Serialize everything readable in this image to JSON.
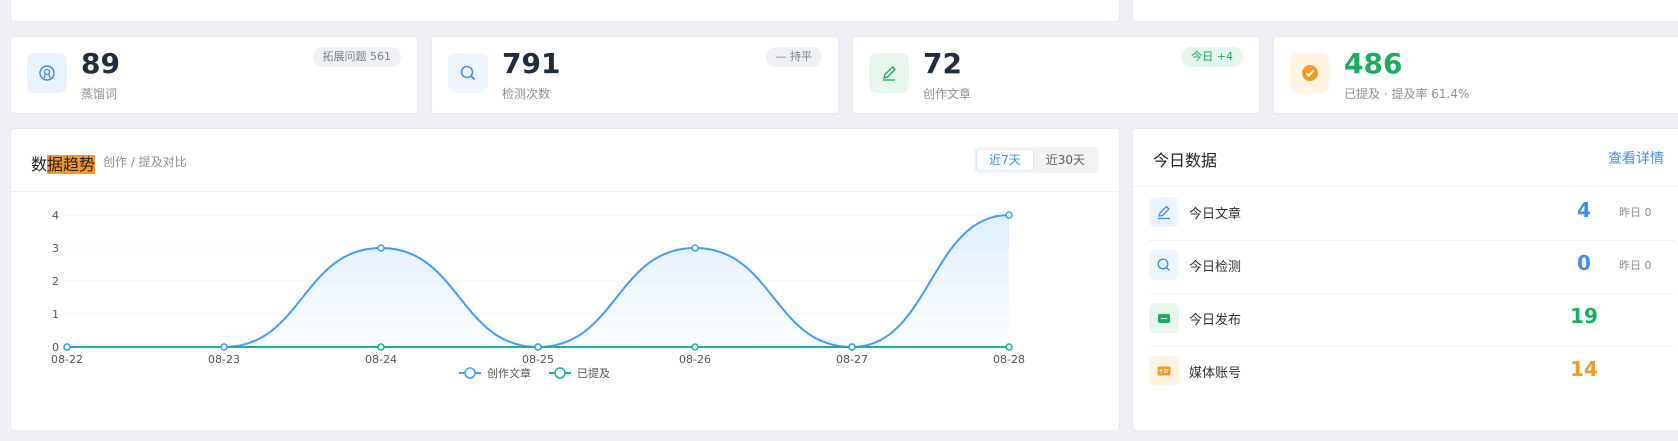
{
  "stats": [
    {
      "value": "89",
      "label": "蒸馏词",
      "badge": "拓展问题 561",
      "icon": "shield-icon",
      "color": "#3b8ff2",
      "bg": "#e8f3fe"
    },
    {
      "value": "791",
      "label": "检测次数",
      "badge": "— 持平",
      "icon": "search-icon",
      "color": "#3b8ff2",
      "bg": "#eef5fe"
    },
    {
      "value": "72",
      "label": "创作文章",
      "badge": "今日 +4",
      "icon": "pen-icon",
      "color": "#1aad5d",
      "bg": "#e7f7ee"
    },
    {
      "value": "486",
      "label": "已提及 · 提及率 61.4%",
      "icon": "check-circle-icon",
      "color": "#f59a23",
      "bg": "#fff3e3"
    }
  ],
  "trend": {
    "title_pre": "数",
    "title_hl": "据趋势",
    "subtitle": "创作 / 提及对比",
    "range_tabs": [
      "近7天",
      "近30天"
    ],
    "active_tab": 0
  },
  "chart_data": {
    "type": "line",
    "x": [
      "08-22",
      "08-23",
      "08-24",
      "08-25",
      "08-26",
      "08-27",
      "08-28"
    ],
    "series": [
      {
        "name": "创作文章",
        "values": [
          0,
          0,
          3,
          0,
          3,
          0,
          4
        ],
        "color": "#409eff",
        "area": true
      },
      {
        "name": "已提及",
        "values": [
          0,
          0,
          0,
          0,
          0,
          0,
          0
        ],
        "color": "#1bb394"
      }
    ],
    "yticks": [
      0,
      1,
      2,
      3,
      4
    ],
    "ylim": [
      0,
      4
    ],
    "grid": true,
    "legend": "bottom-center"
  },
  "today": {
    "title": "今日数据",
    "link": "查看详情",
    "rows": [
      {
        "label": "今日文章",
        "value": "4",
        "yesterday": "昨日 0",
        "color": "#3b8ff2",
        "icon": "pen-icon",
        "icon_color": "#3b8ff2",
        "icon_bg": "#eaf3fe"
      },
      {
        "label": "今日检测",
        "value": "0",
        "yesterday": "昨日 0",
        "color": "#3b8ff2",
        "icon": "search-icon",
        "icon_color": "#3b8ff2",
        "icon_bg": "#eef5fe"
      },
      {
        "label": "今日发布",
        "value": "19",
        "yesterday": "",
        "color": "#1aad5d",
        "icon": "publish-icon",
        "icon_color": "#1aad5d",
        "icon_bg": "#e7f7ee"
      },
      {
        "label": "媒体账号",
        "value": "14",
        "yesterday": "",
        "color": "#f59a23",
        "icon": "id-card-icon",
        "icon_color": "#f59a23",
        "icon_bg": "#fff3e3"
      }
    ]
  }
}
